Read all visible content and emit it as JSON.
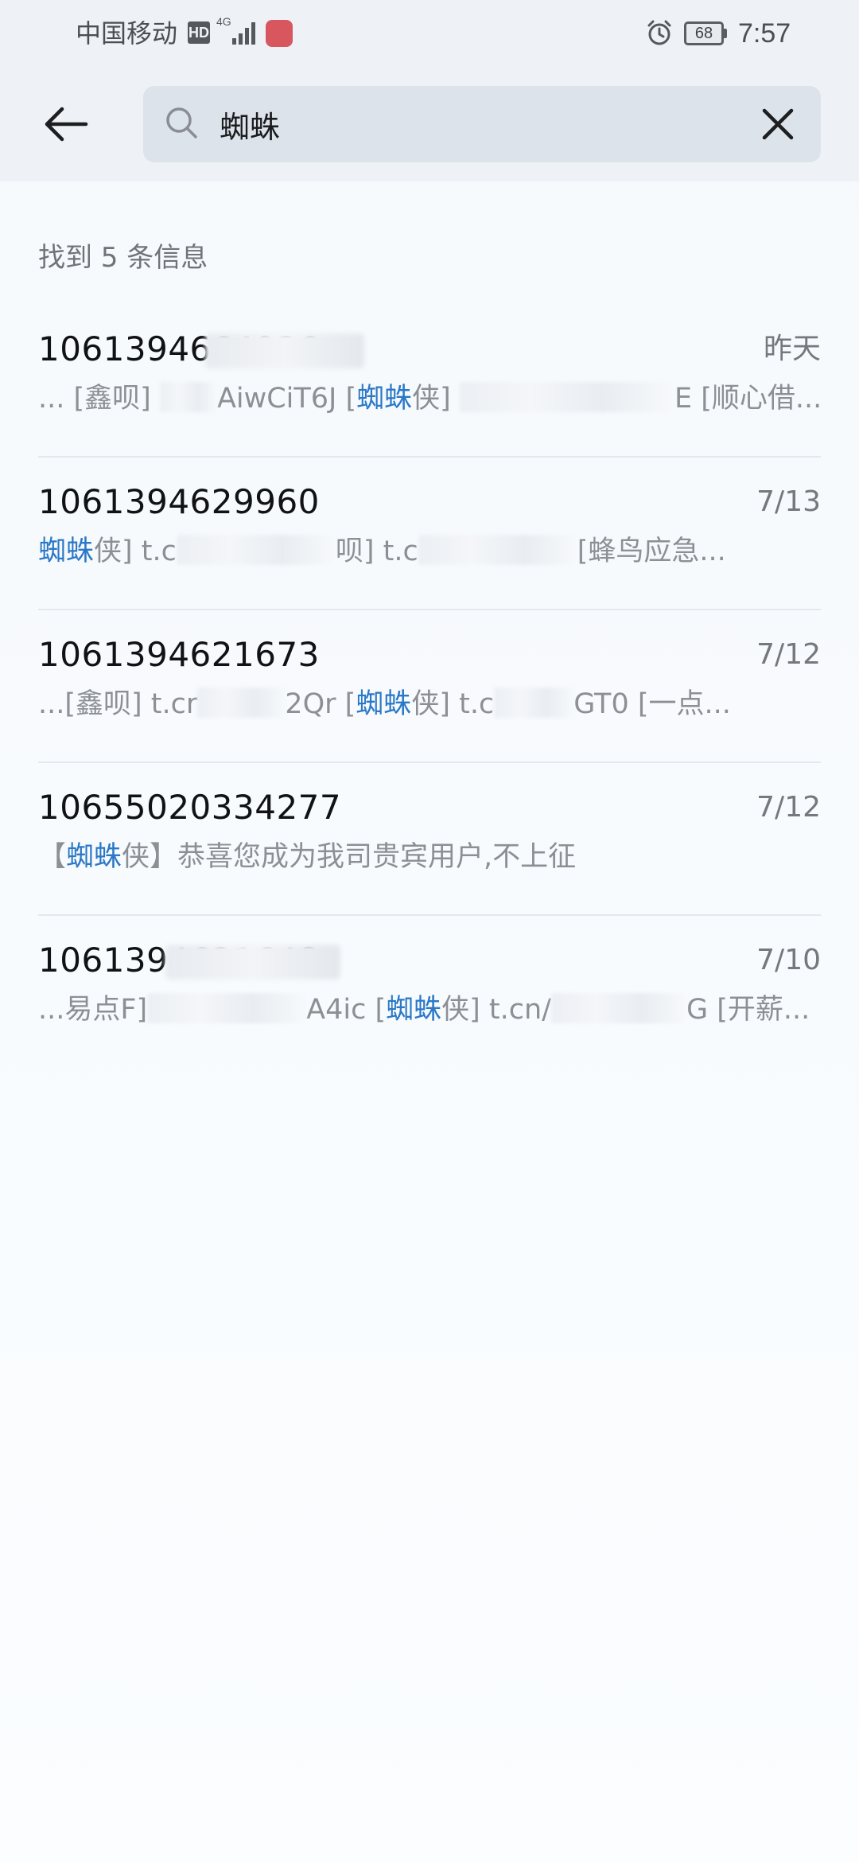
{
  "status_bar": {
    "carrier": "中国移动",
    "hd": "HD",
    "network": "4G",
    "battery": "68",
    "time": "7:57"
  },
  "search": {
    "query": "蜘蛛",
    "placeholder": ""
  },
  "results": {
    "count_text": "找到 5 条信息",
    "items": [
      {
        "sender": "1061394664936",
        "date": "昨天",
        "snippet_before": "... [鑫呗] ",
        "snippet_mid_a": "AiwCiT6J [",
        "highlight": "蜘蛛",
        "snippet_after_a": "侠] ",
        "snippet_tail": "E [顺心借..."
      },
      {
        "sender": "1061394629960",
        "date": "7/13",
        "highlight": "蜘蛛",
        "snippet_after_a": "侠] t.c",
        "snippet_mid_b": "呗] t.c",
        "snippet_tail": "[蜂鸟应急..."
      },
      {
        "sender": "1061394621673",
        "date": "7/12",
        "snippet_before": "...[鑫呗] t.cr",
        "snippet_mid_a": "2Qr [",
        "highlight": "蜘蛛",
        "snippet_after_a": "侠] t.c",
        "snippet_tail": "GT0 [一点..."
      },
      {
        "sender": "10655020334277",
        "date": "7/12",
        "snippet_before": "【",
        "highlight": "蜘蛛",
        "snippet_after_a": "侠】恭喜您成为我司贵宾用户,不上征"
      },
      {
        "sender": "1061394621648",
        "date": "7/10",
        "snippet_before": "...易点F]",
        "snippet_mid_a": "A4ic [",
        "highlight": "蜘蛛",
        "snippet_after_a": "侠] t.cn/",
        "snippet_tail": "G [开薪..."
      }
    ]
  }
}
